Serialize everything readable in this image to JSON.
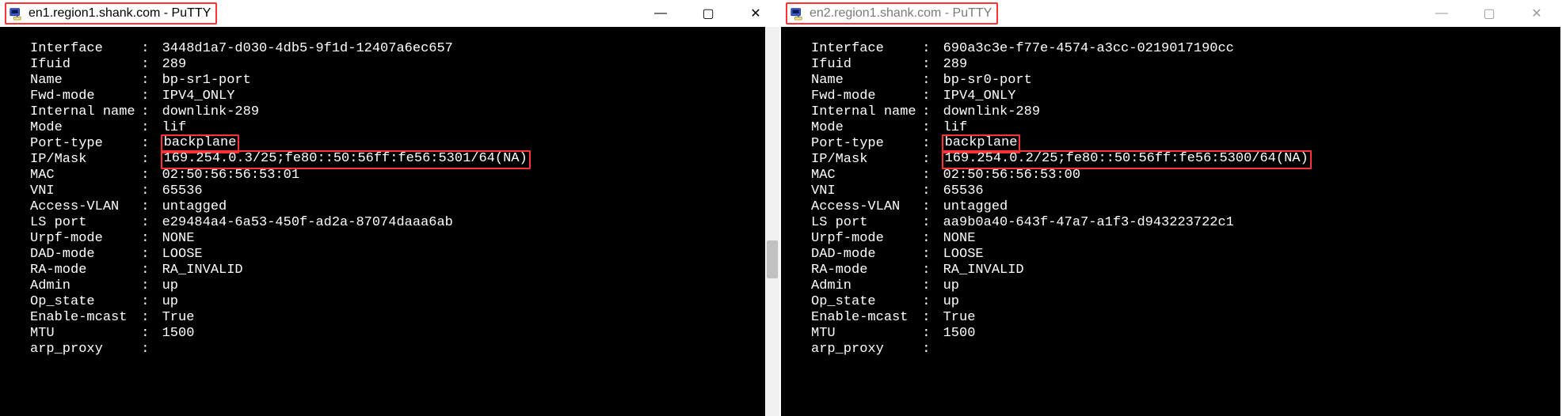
{
  "windows": [
    {
      "title": "en1.region1.shank.com - PuTTY",
      "active": true,
      "highlight_title": true,
      "scrollbar": true,
      "controls": {
        "min": "—",
        "max": "▢",
        "close": "✕"
      },
      "highlights": {
        "port_type": true,
        "ip_mask": true
      },
      "props": {
        "Interface": "3448d1a7-d030-4db5-9f1d-12407a6ec657",
        "Ifuid": "289",
        "Name": "bp-sr1-port",
        "Fwd-mode": "IPV4_ONLY",
        "Internal name": "downlink-289",
        "Mode": "lif",
        "Port-type": "backplane",
        "IP/Mask": "169.254.0.3/25;fe80::50:56ff:fe56:5301/64(NA)",
        "MAC": "02:50:56:56:53:01",
        "VNI": "65536",
        "Access-VLAN": "untagged",
        "LS port": "e29484a4-6a53-450f-ad2a-87074daaa6ab",
        "Urpf-mode": "NONE",
        "DAD-mode": "LOOSE",
        "RA-mode": "RA_INVALID",
        "Admin": "up",
        "Op_state": "up",
        "Enable-mcast": "True",
        "MTU": "1500",
        "arp_proxy": ""
      }
    },
    {
      "title": "en2.region1.shank.com - PuTTY",
      "active": false,
      "highlight_title": true,
      "scrollbar": false,
      "controls": {
        "min": "—",
        "max": "▢",
        "close": "✕"
      },
      "highlights": {
        "port_type": true,
        "ip_mask": true
      },
      "props": {
        "Interface": "690a3c3e-f77e-4574-a3cc-0219017190cc",
        "Ifuid": "289",
        "Name": "bp-sr0-port",
        "Fwd-mode": "IPV4_ONLY",
        "Internal name": "downlink-289",
        "Mode": "lif",
        "Port-type": "backplane",
        "IP/Mask": "169.254.0.2/25;fe80::50:56ff:fe56:5300/64(NA)",
        "MAC": "02:50:56:56:53:00",
        "VNI": "65536",
        "Access-VLAN": "untagged",
        "LS port": "aa9b0a40-643f-47a7-a1f3-d943223722c1",
        "Urpf-mode": "NONE",
        "DAD-mode": "LOOSE",
        "RA-mode": "RA_INVALID",
        "Admin": "up",
        "Op_state": "up",
        "Enable-mcast": "True",
        "MTU": "1500",
        "arp_proxy": ""
      }
    }
  ],
  "prop_order": [
    "Interface",
    "Ifuid",
    "Name",
    "Fwd-mode",
    "Internal name",
    "Mode",
    "Port-type",
    "IP/Mask",
    "MAC",
    "VNI",
    "Access-VLAN",
    "LS port",
    "Urpf-mode",
    "DAD-mode",
    "RA-mode",
    "Admin",
    "Op_state",
    "Enable-mcast",
    "MTU",
    "arp_proxy"
  ],
  "highlight_color": "#ff3333"
}
